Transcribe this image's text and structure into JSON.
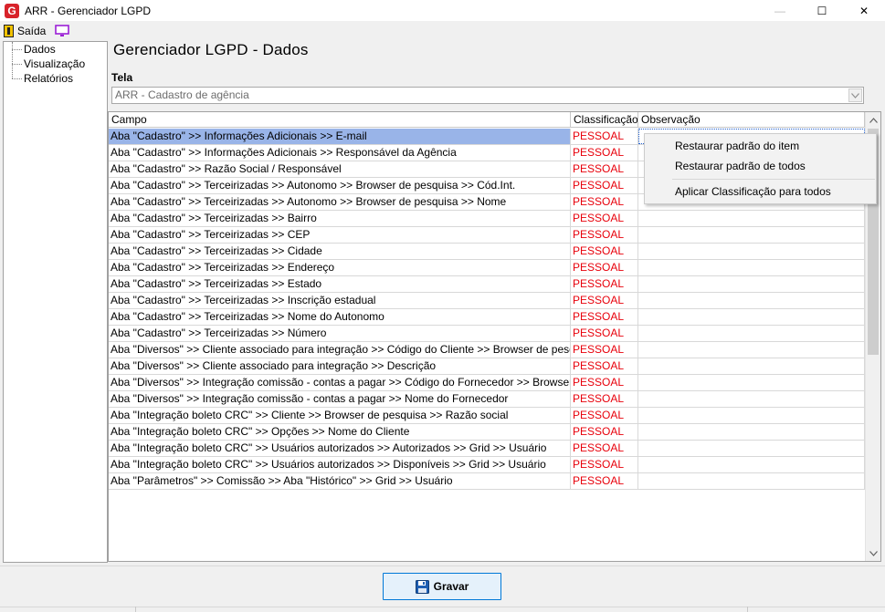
{
  "window": {
    "logo": "G",
    "title": "ARR - Gerenciador LGPD",
    "minimize_glyph": "—",
    "maximize_glyph": "☐",
    "close_glyph": "✕"
  },
  "menu": {
    "exit_label": "Saída"
  },
  "tree": {
    "items": [
      "Dados",
      "Visualização",
      "Relatórios"
    ]
  },
  "main": {
    "title": "Gerenciador LGPD - Dados",
    "tela_label": "Tela",
    "tela_value": "ARR - Cadastro de agência"
  },
  "grid": {
    "headers": [
      "Campo",
      "Classificação",
      "Observação"
    ],
    "rows": [
      {
        "campo": "Aba \"Cadastro\" >> Informações Adicionais >> E-mail",
        "classificacao": "PESSOAL",
        "observacao": ""
      },
      {
        "campo": "Aba \"Cadastro\" >> Informações Adicionais >> Responsável da Agência",
        "classificacao": "PESSOAL",
        "observacao": ""
      },
      {
        "campo": "Aba \"Cadastro\" >> Razão Social / Responsável",
        "classificacao": "PESSOAL",
        "observacao": ""
      },
      {
        "campo": "Aba \"Cadastro\" >> Terceirizadas >> Autonomo >> Browser de pesquisa >> Cód.Int.",
        "classificacao": "PESSOAL",
        "observacao": ""
      },
      {
        "campo": "Aba \"Cadastro\" >> Terceirizadas >> Autonomo >> Browser de pesquisa >> Nome",
        "classificacao": "PESSOAL",
        "observacao": ""
      },
      {
        "campo": "Aba \"Cadastro\" >> Terceirizadas >> Bairro",
        "classificacao": "PESSOAL",
        "observacao": ""
      },
      {
        "campo": "Aba \"Cadastro\" >> Terceirizadas >> CEP",
        "classificacao": "PESSOAL",
        "observacao": ""
      },
      {
        "campo": "Aba \"Cadastro\" >> Terceirizadas >> Cidade",
        "classificacao": "PESSOAL",
        "observacao": ""
      },
      {
        "campo": "Aba \"Cadastro\" >> Terceirizadas >> Endereço",
        "classificacao": "PESSOAL",
        "observacao": ""
      },
      {
        "campo": "Aba \"Cadastro\" >> Terceirizadas >> Estado",
        "classificacao": "PESSOAL",
        "observacao": ""
      },
      {
        "campo": "Aba \"Cadastro\" >> Terceirizadas >> Inscrição estadual",
        "classificacao": "PESSOAL",
        "observacao": ""
      },
      {
        "campo": "Aba \"Cadastro\" >> Terceirizadas >> Nome do  Autonomo",
        "classificacao": "PESSOAL",
        "observacao": ""
      },
      {
        "campo": "Aba \"Cadastro\" >> Terceirizadas >> Número",
        "classificacao": "PESSOAL",
        "observacao": ""
      },
      {
        "campo": "Aba \"Diversos\" >> Cliente associado para integração >> Código do Cliente >> Browser de pesquisa >> ...",
        "classificacao": "PESSOAL",
        "observacao": ""
      },
      {
        "campo": "Aba \"Diversos\" >> Cliente associado para integração >> Descrição",
        "classificacao": "PESSOAL",
        "observacao": ""
      },
      {
        "campo": "Aba \"Diversos\" >> Integração comissão - contas a pagar >> Código do Fornecedor >> Browser de pesquisa ...",
        "classificacao": "PESSOAL",
        "observacao": ""
      },
      {
        "campo": "Aba \"Diversos\" >> Integração comissão - contas a pagar >> Nome do Fornecedor",
        "classificacao": "PESSOAL",
        "observacao": ""
      },
      {
        "campo": "Aba \"Integração boleto CRC\" >> Cliente >> Browser de pesquisa >> Razão social",
        "classificacao": "PESSOAL",
        "observacao": ""
      },
      {
        "campo": "Aba \"Integração boleto CRC\" >> Opções >> Nome do Cliente",
        "classificacao": "PESSOAL",
        "observacao": ""
      },
      {
        "campo": "Aba \"Integração boleto CRC\" >> Usuários autorizados >> Autorizados >> Grid >> Usuário",
        "classificacao": "PESSOAL",
        "observacao": ""
      },
      {
        "campo": "Aba \"Integração boleto CRC\" >> Usuários autorizados >> Disponíveis >> Grid >> Usuário",
        "classificacao": "PESSOAL",
        "observacao": ""
      },
      {
        "campo": "Aba \"Parâmetros\" >> Comissão >> Aba \"Histórico\" >> Grid >> Usuário",
        "classificacao": "PESSOAL",
        "observacao": ""
      }
    ],
    "selected_index": 0
  },
  "context_menu": {
    "items": [
      "Restaurar padrão do item",
      "Restaurar padrão de todos",
      "Aplicar Classificação para todos"
    ]
  },
  "footer": {
    "save_label": "Gravar"
  },
  "colors": {
    "classification": "#e8000b",
    "selection": "#99b4e8",
    "button_border": "#0078d7"
  },
  "icons": {
    "app": "app-logo-icon",
    "exit": "exit-door-icon",
    "monitor": "monitor-icon",
    "save": "floppy-disk-icon"
  }
}
